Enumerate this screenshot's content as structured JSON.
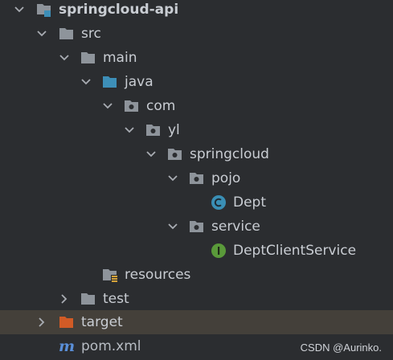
{
  "tree": {
    "root": {
      "label": "springcloud-api",
      "icon": "module-folder-icon",
      "expanded": true
    },
    "src": {
      "label": "src",
      "icon": "folder-icon",
      "expanded": true
    },
    "main": {
      "label": "main",
      "icon": "folder-icon",
      "expanded": true
    },
    "java": {
      "label": "java",
      "icon": "source-root-folder-icon",
      "expanded": true
    },
    "com": {
      "label": "com",
      "icon": "package-icon",
      "expanded": true
    },
    "yl": {
      "label": "yl",
      "icon": "package-icon",
      "expanded": true
    },
    "springcloud": {
      "label": "springcloud",
      "icon": "package-icon",
      "expanded": true
    },
    "pojo": {
      "label": "pojo",
      "icon": "package-icon",
      "expanded": true
    },
    "dept": {
      "label": "Dept",
      "icon": "class-icon",
      "icon_letter": "C"
    },
    "service": {
      "label": "service",
      "icon": "package-icon",
      "expanded": true
    },
    "dept_client_service": {
      "label": "DeptClientService",
      "icon": "interface-icon",
      "icon_letter": "I"
    },
    "resources": {
      "label": "resources",
      "icon": "resources-folder-icon"
    },
    "test": {
      "label": "test",
      "icon": "folder-icon",
      "expanded": false
    },
    "target": {
      "label": "target",
      "icon": "excluded-folder-icon",
      "expanded": false
    },
    "pom": {
      "label": "pom.xml",
      "icon": "maven-icon",
      "icon_letter": "m"
    }
  },
  "colors": {
    "background": "#2b2d30",
    "selected_row": "#44403a",
    "folder": "#8e949b",
    "source_folder": "#3d8fb8",
    "excluded_folder": "#d15b26",
    "class_icon": "#3a8fb5",
    "interface_icon": "#5a9a3a",
    "maven_icon": "#5a8fd8"
  },
  "watermark": "CSDN @Aurinko."
}
